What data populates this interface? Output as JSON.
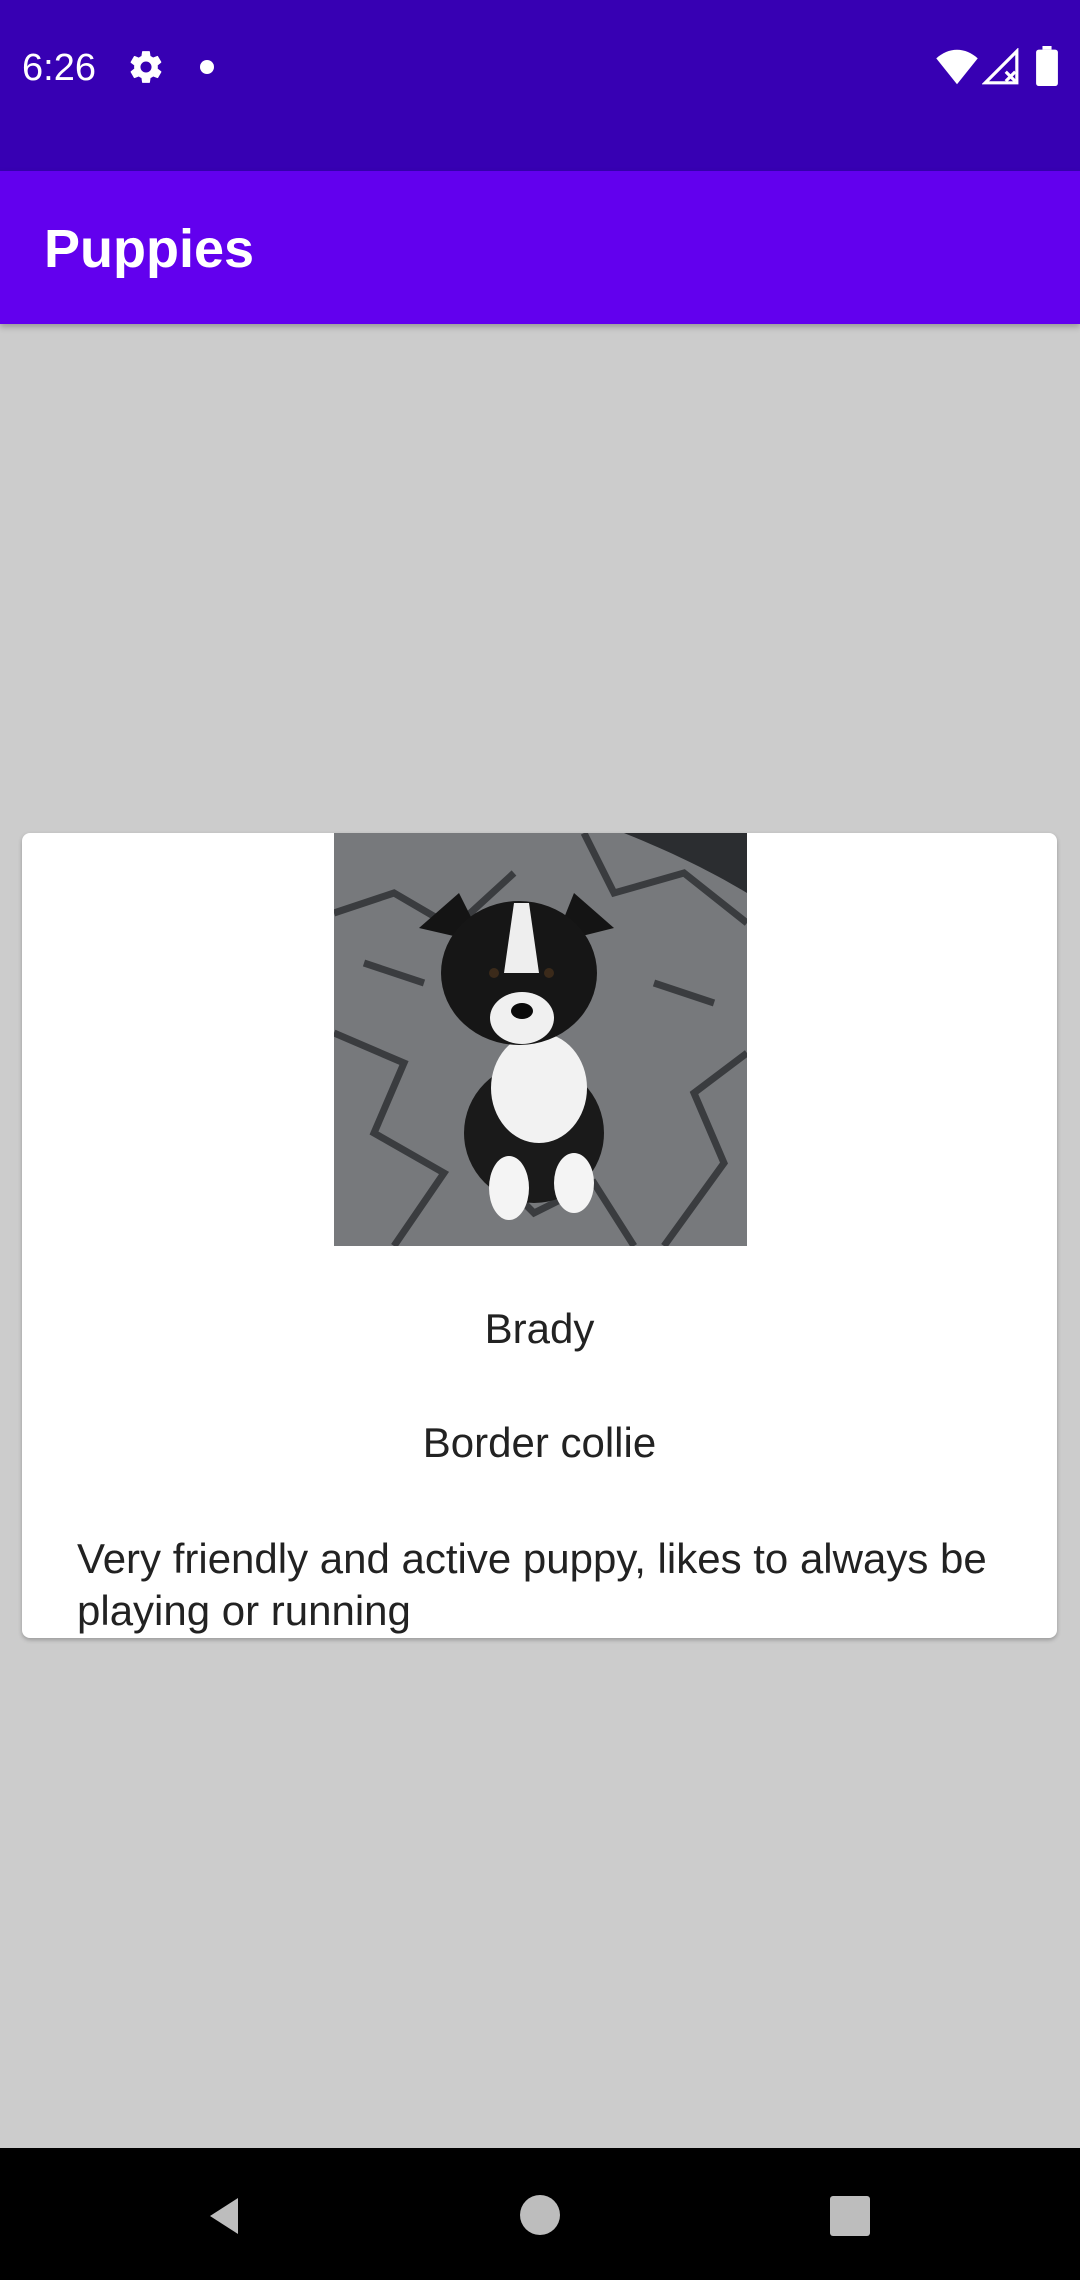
{
  "status_bar": {
    "time": "6:26",
    "icons": [
      "gear-icon",
      "notification-dot-icon",
      "wifi-icon",
      "signal-icon",
      "battery-icon"
    ],
    "background_color": "#3700b3"
  },
  "app_bar": {
    "title": "Puppies",
    "background_color": "#6200ee"
  },
  "card": {
    "image": "border-collie-puppy-photo",
    "name": "Brady",
    "breed": "Border collie",
    "description": "Very friendly and active puppy, likes to always be playing or running"
  },
  "nav_bar": {
    "icons": [
      "back-icon",
      "home-icon",
      "recents-icon"
    ]
  }
}
